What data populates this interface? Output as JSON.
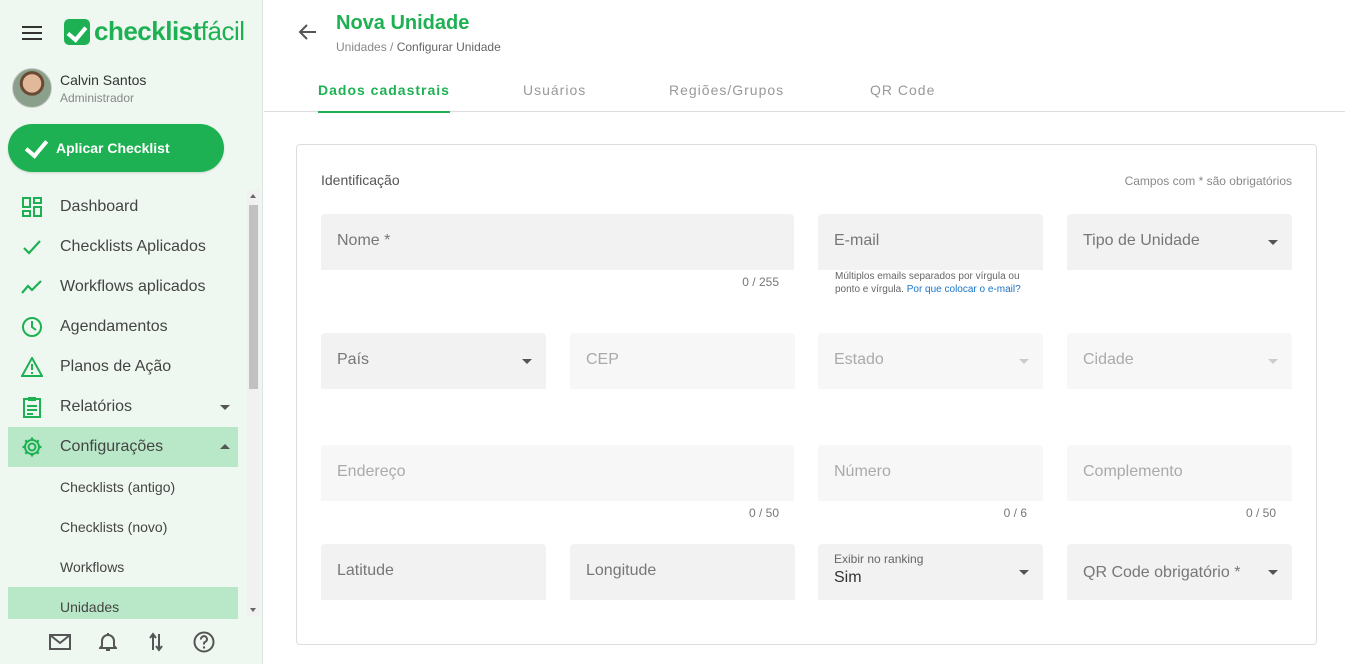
{
  "app": {
    "logo_bold": "checklist",
    "logo_light": "fácil"
  },
  "user": {
    "name": "Calvin Santos",
    "role": "Administrador"
  },
  "apply_button": "Aplicar Checklist",
  "nav": {
    "dashboard": "Dashboard",
    "checklists_aplicados": "Checklists Aplicados",
    "workflows_aplicados": "Workflows aplicados",
    "agendamentos": "Agendamentos",
    "planos_de_acao": "Planos de Ação",
    "relatorios": "Relatórios",
    "configuracoes": "Configurações",
    "sub": {
      "checklists_antigo": "Checklists (antigo)",
      "checklists_novo": "Checklists (novo)",
      "workflows": "Workflows",
      "unidades": "Unidades"
    }
  },
  "colors": {
    "accent": "#1eb153",
    "active_bg": "#b9e8c8",
    "sidebar_bg": "#eef8f1"
  },
  "header": {
    "title": "Nova Unidade",
    "breadcrumb_parent": "Unidades /",
    "breadcrumb_current": "Configurar Unidade"
  },
  "tabs": {
    "dados": "Dados cadastrais",
    "usuarios": "Usuários",
    "regioes": "Regiões/Grupos",
    "qrcode": "QR Code"
  },
  "form": {
    "section_title": "Identificação",
    "required_note": "Campos com * são obrigatórios",
    "nome": {
      "label": "Nome *",
      "counter": "0 / 255"
    },
    "email": {
      "label": "E-mail",
      "hint": "Múltiplos emails separados por vírgula ou ponto e vírgula.",
      "hint_link": "Por que colocar o e-mail?"
    },
    "tipo_unidade": {
      "label": "Tipo de Unidade"
    },
    "pais": {
      "label": "País"
    },
    "cep": {
      "label": "CEP"
    },
    "estado": {
      "label": "Estado"
    },
    "cidade": {
      "label": "Cidade"
    },
    "endereco": {
      "label": "Endereço",
      "counter": "0 / 50"
    },
    "numero": {
      "label": "Número",
      "counter": "0 / 6"
    },
    "complemento": {
      "label": "Complemento",
      "counter": "0 / 50"
    },
    "latitude": {
      "label": "Latitude"
    },
    "longitude": {
      "label": "Longitude"
    },
    "ranking": {
      "label": "Exibir no ranking",
      "value": "Sim"
    },
    "qr_obrigatorio": {
      "label": "QR Code obrigatório *"
    }
  },
  "icons": {
    "menu": "hamburger-icon",
    "back": "arrow-left-icon",
    "mail": "mail-icon",
    "bell": "bell-icon",
    "sync": "arrows-updown-icon",
    "help": "help-circle-icon"
  }
}
